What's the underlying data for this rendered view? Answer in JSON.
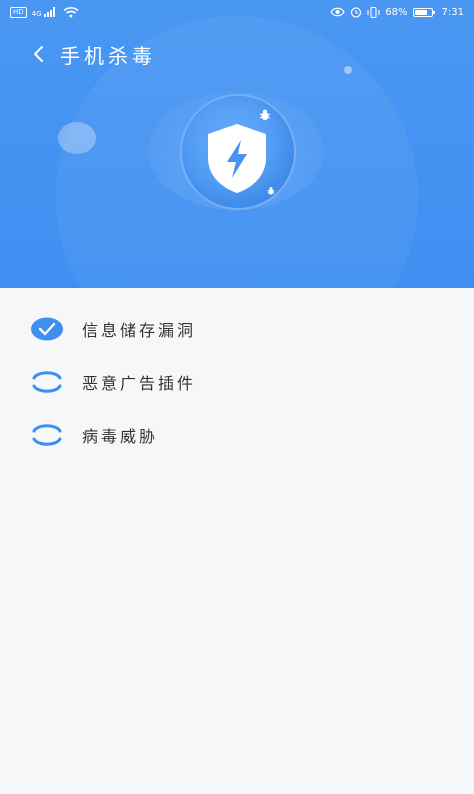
{
  "status_bar": {
    "hd": "HD",
    "net": "4G",
    "battery": "68%",
    "time": "7:31"
  },
  "header": {
    "title": "手机杀毒"
  },
  "scan_items": [
    {
      "label": "信息储存漏洞",
      "status": "done"
    },
    {
      "label": "恶意广告插件",
      "status": "scanning"
    },
    {
      "label": "病毒威胁",
      "status": "scanning"
    }
  ],
  "colors": {
    "primary": "#3f8ff2",
    "hero_background": "#4a97f3",
    "page_background": "#f6f7f9",
    "text": "#333333"
  }
}
